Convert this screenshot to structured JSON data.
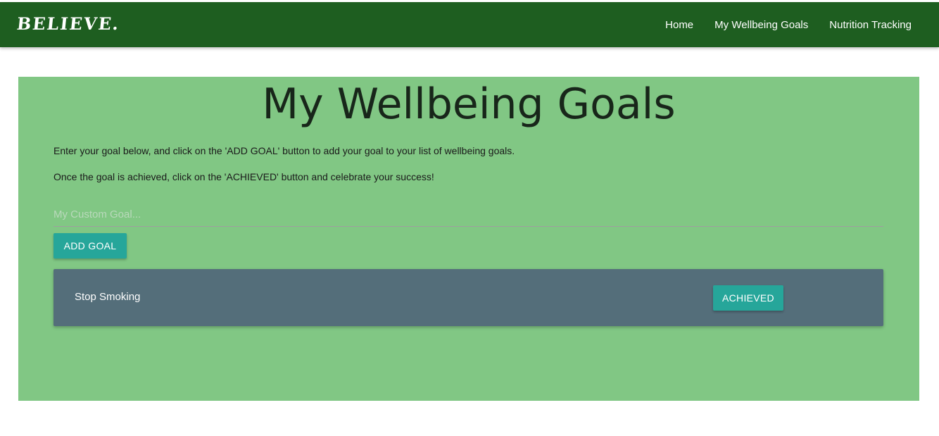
{
  "navbar": {
    "brand": "BELIEVE.",
    "links": [
      "Home",
      "My Wellbeing Goals",
      "Nutrition Tracking"
    ],
    "background": "#1e5e20"
  },
  "main": {
    "title": "My Wellbeing Goals",
    "intro_1": "Enter your goal below, and click on the 'ADD GOAL' button to add your goal to your list of wellbeing goals.",
    "intro_2": "Once the goal is achieved, click on the 'ACHIEVED' button and celebrate your success!",
    "goal_input": {
      "placeholder": "My Custom Goal...",
      "value": ""
    },
    "add_button_label": "ADD GOAL",
    "panel_background": "#81c784",
    "goals": [
      {
        "text": "Stop Smoking",
        "button_label": "ACHIEVED"
      }
    ],
    "card_background": "#546e7a",
    "button_color": "#26a69a"
  }
}
